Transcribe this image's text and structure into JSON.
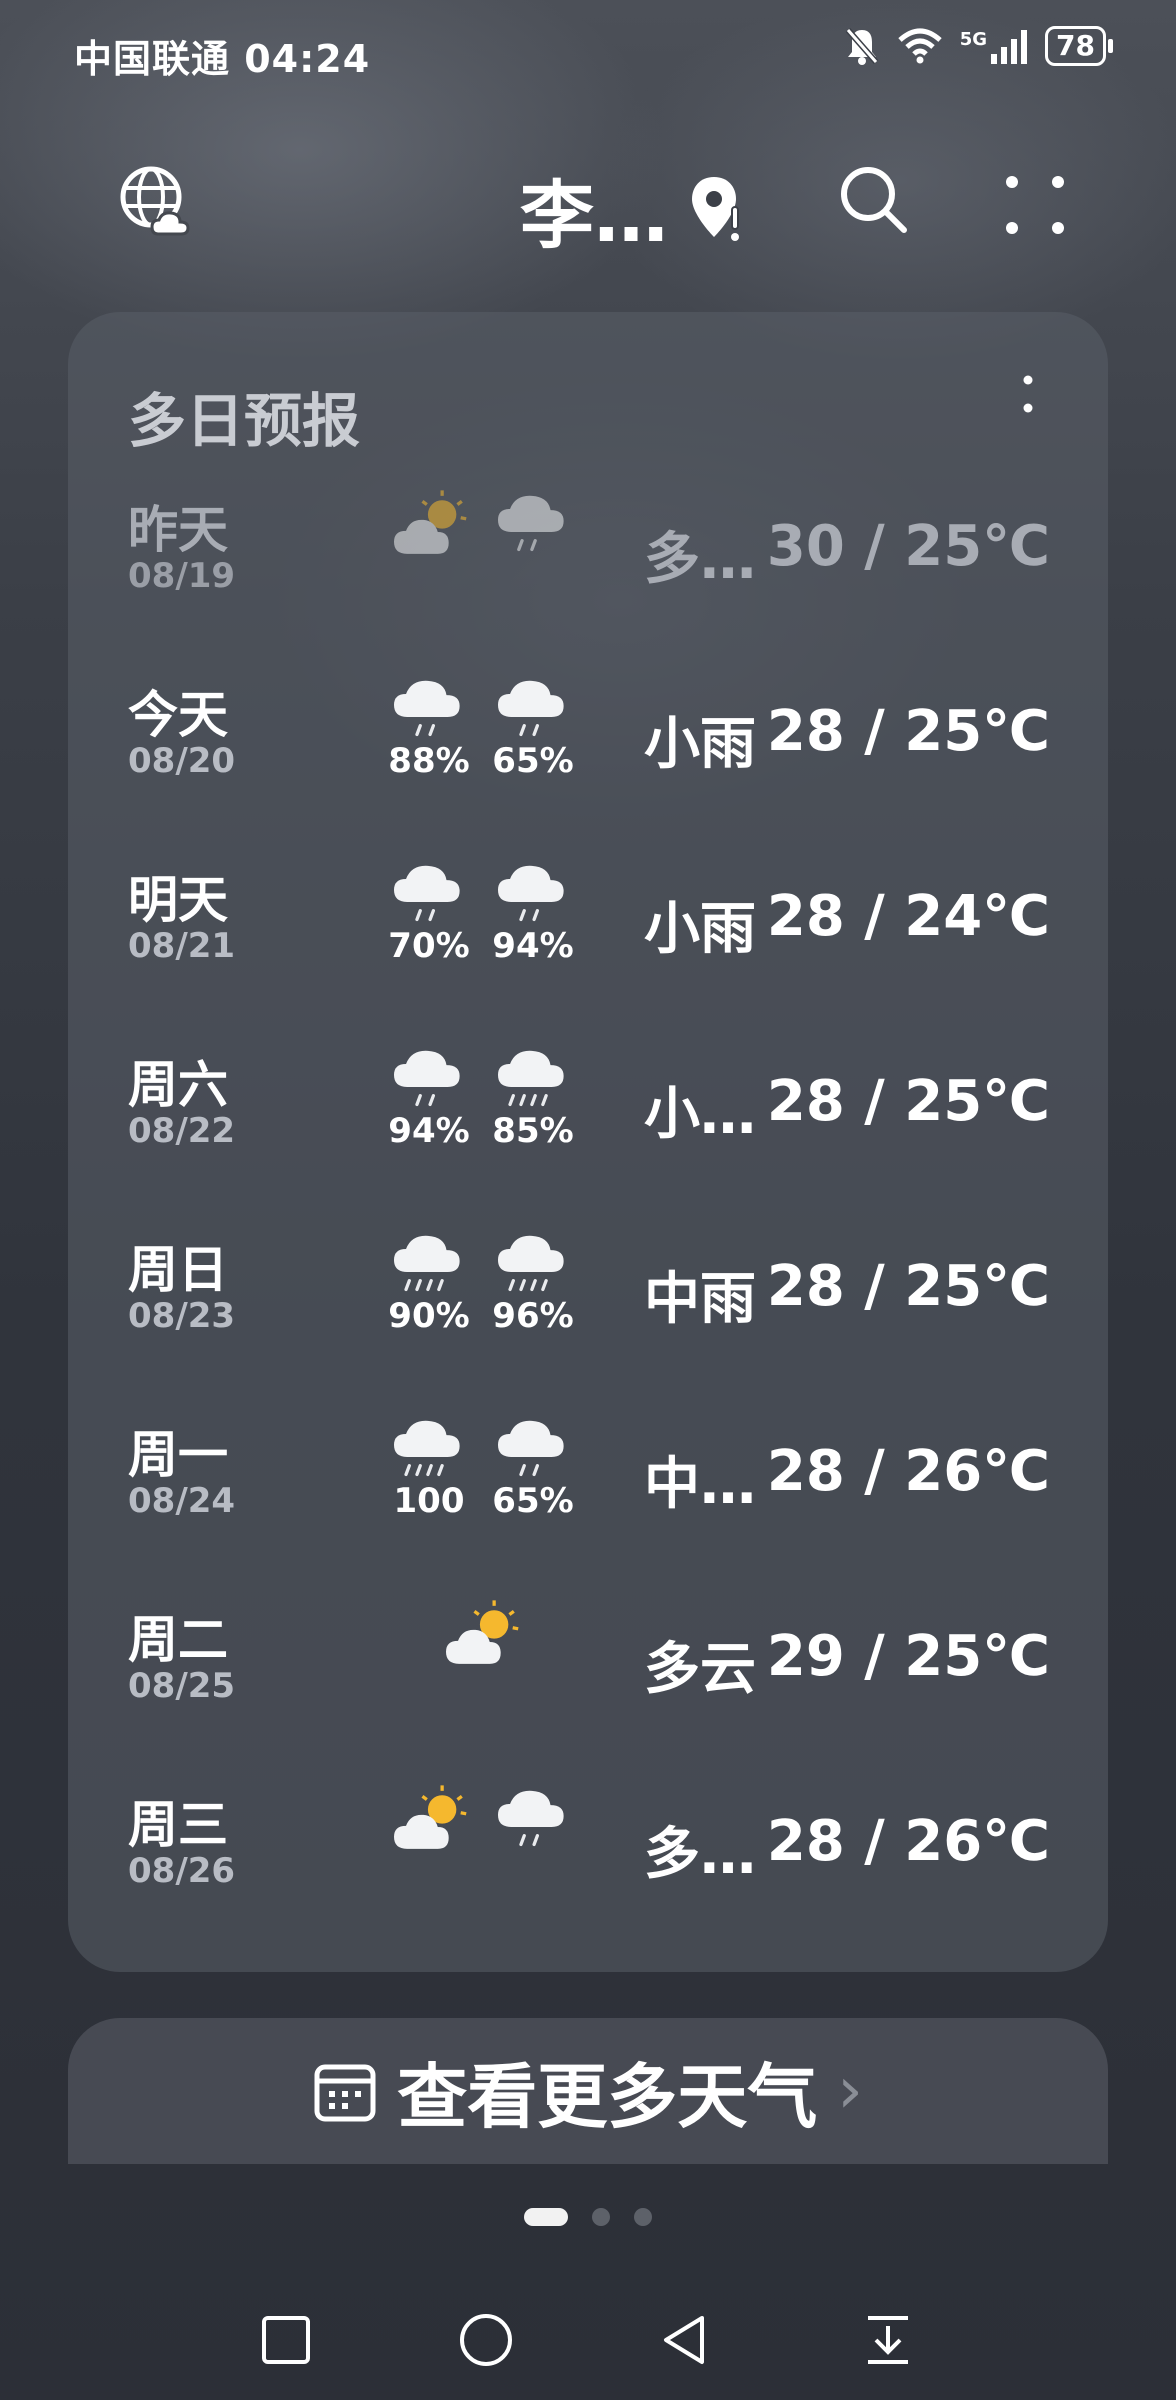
{
  "status_bar": {
    "carrier_time": "中国联通 04:24",
    "network": "5G",
    "battery": "78"
  },
  "header": {
    "city": "李…"
  },
  "forecast": {
    "title": "多日预报",
    "days": [
      {
        "day": "昨天",
        "date": "08/19",
        "icons": [
          "partly-cloudy-icon",
          "rain-cloud-icon"
        ],
        "probs": [
          "",
          ""
        ],
        "desc": "多…",
        "temp": "30 / 25℃",
        "dim": true
      },
      {
        "day": "今天",
        "date": "08/20",
        "icons": [
          "light-rain-icon",
          "light-rain-icon"
        ],
        "probs": [
          "88%",
          "65%"
        ],
        "desc": "小雨",
        "temp": "28 / 25℃"
      },
      {
        "day": "明天",
        "date": "08/21",
        "icons": [
          "light-rain-icon",
          "light-rain-icon"
        ],
        "probs": [
          "70%",
          "94%"
        ],
        "desc": "小雨",
        "temp": "28 / 24℃"
      },
      {
        "day": "周六",
        "date": "08/22",
        "icons": [
          "light-rain-icon",
          "moderate-rain-icon"
        ],
        "probs": [
          "94%",
          "85%"
        ],
        "desc": "小…",
        "temp": "28 / 25℃"
      },
      {
        "day": "周日",
        "date": "08/23",
        "icons": [
          "moderate-rain-icon",
          "moderate-rain-icon"
        ],
        "probs": [
          "90%",
          "96%"
        ],
        "desc": "中雨",
        "temp": "28 / 25℃"
      },
      {
        "day": "周一",
        "date": "08/24",
        "icons": [
          "moderate-rain-icon",
          "light-rain-icon"
        ],
        "probs": [
          "100",
          "65%"
        ],
        "desc": "中…",
        "temp": "28 / 26℃"
      },
      {
        "day": "周二",
        "date": "08/25",
        "icons": [
          "partly-cloudy-icon"
        ],
        "probs": [
          ""
        ],
        "desc": "多云",
        "temp": "29 / 25℃"
      },
      {
        "day": "周三",
        "date": "08/26",
        "icons": [
          "partly-cloudy-icon",
          "light-rain-icon"
        ],
        "probs": [
          "",
          ""
        ],
        "desc": "多…",
        "temp": "28 / 26℃"
      }
    ]
  },
  "more_button": {
    "label": "查看更多天气"
  },
  "page_indicator": {
    "count": 3,
    "active": 0
  },
  "colors": {
    "sun": "#f5b82e",
    "cloud": "#f2f3f5",
    "rain": "#e9ebee"
  }
}
